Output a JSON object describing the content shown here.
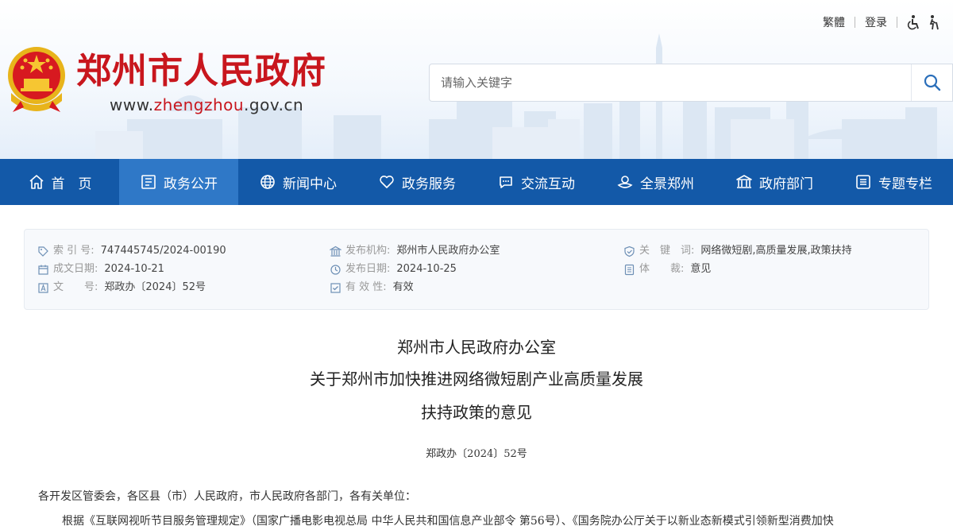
{
  "header": {
    "site_title": "郑州市人民政府",
    "url_prefix": "www.",
    "url_mid": "zhengzhou",
    "url_suffix": ".gov.cn",
    "top_links": {
      "traditional": "繁體",
      "login": "登录"
    },
    "search_placeholder": "请输入关键字",
    "icons": [
      "accessibility-icon",
      "elderly-mode-icon",
      "search-icon"
    ]
  },
  "nav": {
    "items": [
      {
        "label": "首　页",
        "icon": "home-icon"
      },
      {
        "label": "政务公开",
        "icon": "document-icon",
        "active": true
      },
      {
        "label": "新闻中心",
        "icon": "globe-icon"
      },
      {
        "label": "政务服务",
        "icon": "heart-icon"
      },
      {
        "label": "交流互动",
        "icon": "chat-icon"
      },
      {
        "label": "全景郑州",
        "icon": "panorama-icon"
      },
      {
        "label": "政府部门",
        "icon": "building-icon"
      },
      {
        "label": "专题专栏",
        "icon": "list-icon"
      }
    ]
  },
  "meta": {
    "index_no": {
      "label": "索  引  号:",
      "value": "747445745/2024-00190"
    },
    "created": {
      "label": "成文日期:",
      "value": "2024-10-21"
    },
    "doc_no": {
      "label": "文　　号:",
      "value": "郑政办〔2024〕52号"
    },
    "publisher": {
      "label": "发布机构:",
      "value": "郑州市人民政府办公室"
    },
    "published": {
      "label": "发布日期:",
      "value": "2024-10-25"
    },
    "validity": {
      "label": "有  效  性:",
      "value": "有效"
    },
    "keywords": {
      "label": "关　键　词:",
      "value": "网络微短剧,高质量发展,政策扶持"
    },
    "genre": {
      "label": "体　　裁:",
      "value": "意见"
    }
  },
  "article": {
    "title_lines": [
      "郑州市人民政府办公室",
      "关于郑州市加快推进网络微短剧产业高质量发展",
      "扶持政策的意见"
    ],
    "doc_number": "郑政办〔2024〕52号",
    "salutation": "各开发区管委会，各区县（市）人民政府，市人民政府各部门，各有关单位：",
    "body_first_line": "根据《互联网视听节目服务管理规定》（国家广播电影电视总局 中华人民共和国信息产业部令 第56号）、《国务院办公厅关于以新业态新模式引领新型消费加快"
  },
  "colors": {
    "brand_red": "#c8161d",
    "nav_blue": "#1359a8",
    "nav_active": "#2f78c7"
  }
}
